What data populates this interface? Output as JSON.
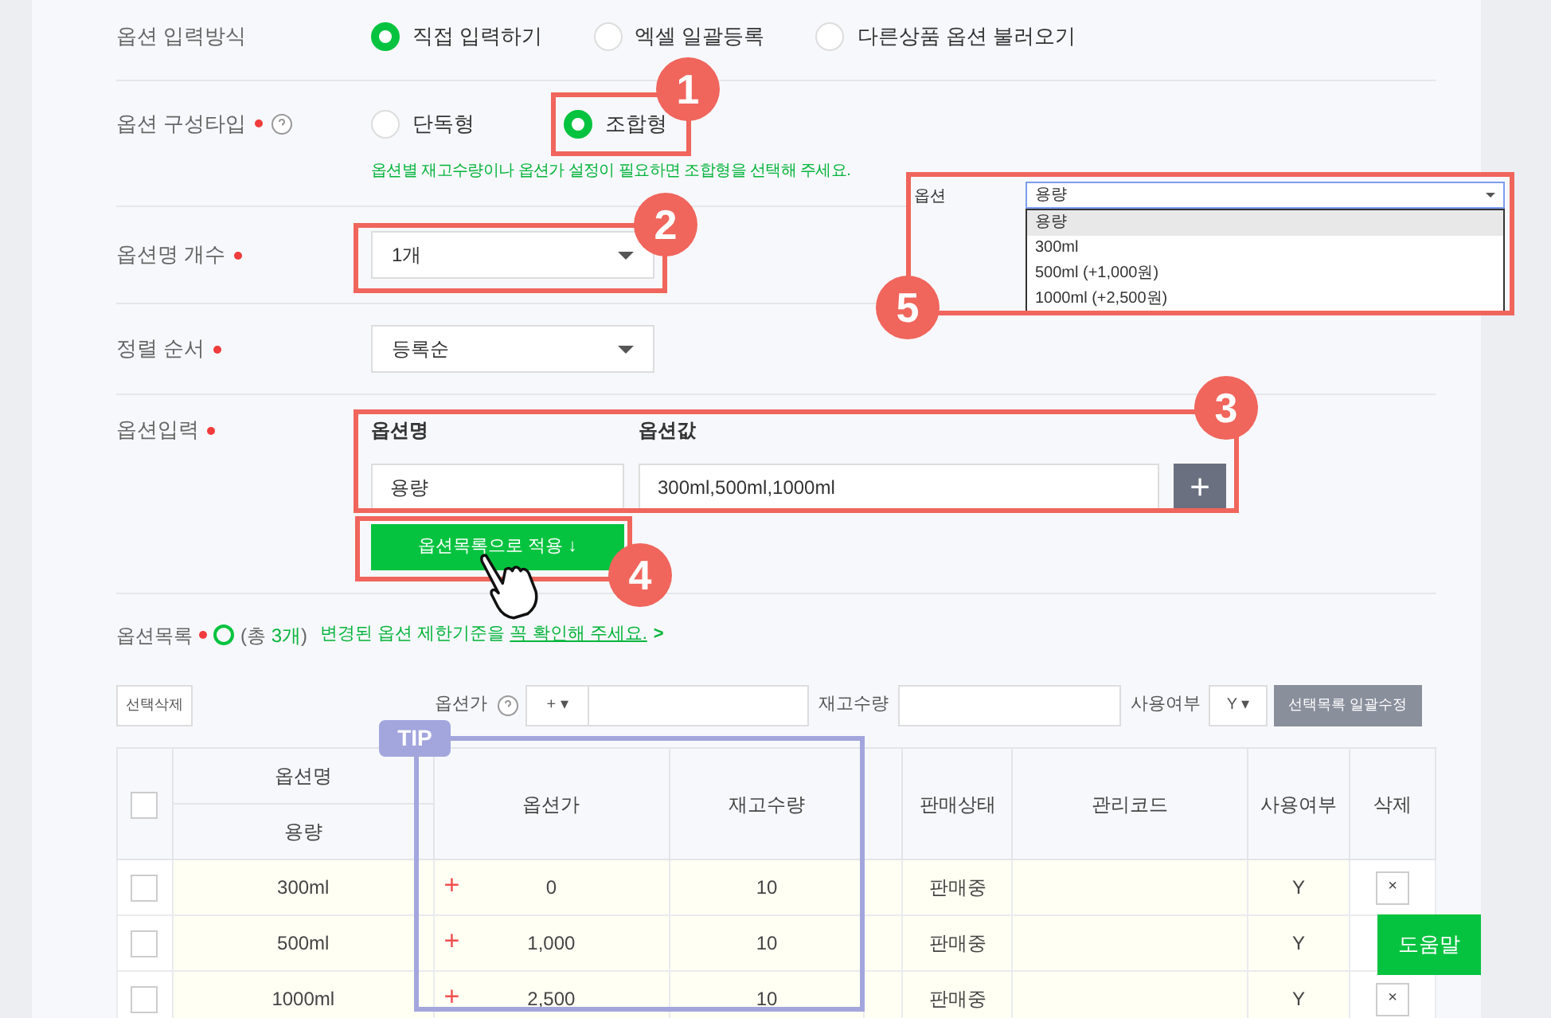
{
  "input_method": {
    "label": "옵션 입력방식",
    "options": [
      {
        "label": "직접 입력하기",
        "selected": true
      },
      {
        "label": "엑셀 일괄등록",
        "selected": false
      },
      {
        "label": "다른상품 옵션 불러오기",
        "selected": false
      }
    ]
  },
  "composition_type": {
    "label": "옵션 구성타입",
    "required": true,
    "options": [
      {
        "label": "단독형",
        "selected": false
      },
      {
        "label": "조합형",
        "selected": true
      }
    ],
    "hint": "옵션별 재고수량이나 옵션가 설정이 필요하면 조합형을 선택해 주세요."
  },
  "option_name_count": {
    "label": "옵션명 개수",
    "required": true,
    "value": "1개"
  },
  "sort_order": {
    "label": "정렬 순서",
    "required": true,
    "value": "등록순"
  },
  "option_input": {
    "label": "옵션입력",
    "required": true,
    "name_header": "옵션명",
    "value_header": "옵션값",
    "name_value": "용량",
    "values_value": "300ml,500ml,1000ml",
    "add_button": "+",
    "apply_button": "옵션목록으로 적용 ↓"
  },
  "option_list": {
    "label": "옵션목록",
    "required": true,
    "count_prefix": "(총 ",
    "count": "3개",
    "count_suffix": ")",
    "notice": "변경된 옵션 제한기준을 ",
    "notice_link": "꼭 확인해 주세요.",
    "notice_arrow": ">"
  },
  "toolbar": {
    "delete_selected": "선택삭제",
    "price_label": "옵션가",
    "price_sign": "+ ▾",
    "stock_label": "재고수량",
    "usage_label": "사용여부",
    "usage_value": "Y ▾",
    "bulk_edit": "선택목록 일괄수정"
  },
  "table": {
    "all_checked": false,
    "group_header": "옵션명",
    "columns": [
      "용량",
      "옵션가",
      "재고수량",
      "판매상태",
      "관리코드",
      "사용여부",
      "삭제"
    ],
    "rows": [
      {
        "checked": false,
        "name": "300ml",
        "sign": "+",
        "price": "0",
        "stock": "10",
        "status": "판매중",
        "usage": "Y",
        "delete": "×"
      },
      {
        "checked": false,
        "name": "500ml",
        "sign": "+",
        "price": "1,000",
        "stock": "10",
        "status": "판매중",
        "usage": "Y"
      },
      {
        "checked": false,
        "name": "1000ml",
        "sign": "+",
        "price": "2,500",
        "stock": "10",
        "status": "판매중",
        "usage": "Y",
        "delete": "×"
      }
    ]
  },
  "tip_badge": "TIP",
  "preview": {
    "label": "옵션",
    "value": "용량",
    "items": [
      {
        "label": "용량",
        "selected": true
      },
      {
        "label": "300ml",
        "selected": false
      },
      {
        "label": "500ml (+1,000원)",
        "selected": false
      },
      {
        "label": "1000ml (+2,500원)",
        "selected": false
      }
    ]
  },
  "callouts": [
    "1",
    "2",
    "3",
    "4",
    "5"
  ],
  "help_button": "도움말"
}
